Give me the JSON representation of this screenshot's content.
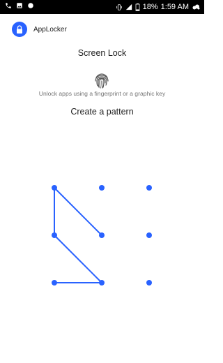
{
  "status_bar": {
    "battery_percent": "18%",
    "time": "1:59 AM",
    "icons": [
      "phone-icon",
      "image-icon",
      "app-icon",
      "vibrate-icon",
      "signal-icon",
      "battery-icon",
      "cloud-icon"
    ]
  },
  "app": {
    "name": "AppLocker",
    "icon": "lock-icon",
    "accent_color": "#2962ff"
  },
  "screen": {
    "title": "Screen Lock",
    "fingerprint_icon": "fingerprint-icon",
    "subtitle": "Unlock apps using a fingerprint or a graphic key",
    "pattern_title": "Create a pattern"
  },
  "pattern": {
    "rows": 3,
    "cols": 3,
    "drawn_sequence": [
      5,
      1,
      4,
      8,
      7
    ]
  }
}
